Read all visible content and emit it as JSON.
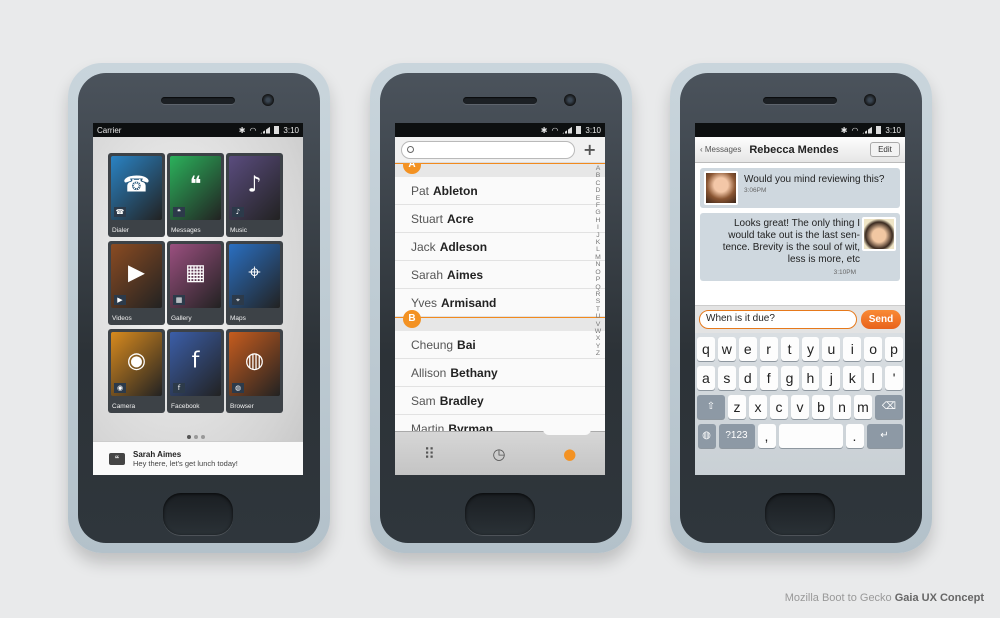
{
  "status": {
    "carrier": "Carrier",
    "time": "3:10"
  },
  "home": {
    "apps": [
      {
        "label": "Dialer",
        "color": "#2a83c4",
        "icon": "phone-icon"
      },
      {
        "label": "Messages",
        "color": "#2bb15b",
        "icon": "quote-icon"
      },
      {
        "label": "Music",
        "color": "#5a4c7e",
        "icon": "music-note-icon"
      },
      {
        "label": "Videos",
        "color": "#8a4b22",
        "icon": "video-camera-icon"
      },
      {
        "label": "Gallery",
        "color": "#9a4f7f",
        "icon": "grid-icon"
      },
      {
        "label": "Maps",
        "color": "#2a6fc1",
        "icon": "map-pin-icon"
      },
      {
        "label": "Camera",
        "color": "#d88a1e",
        "icon": "camera-icon"
      },
      {
        "label": "Facebook",
        "color": "#3b5ea8",
        "icon": "facebook-icon"
      },
      {
        "label": "Browser",
        "color": "#c65c1e",
        "icon": "globe-icon"
      }
    ],
    "notification": {
      "name": "Sarah Aimes",
      "text": "Hey there, let's get lunch today!"
    }
  },
  "contacts": {
    "sections": [
      {
        "letter": "A",
        "people": [
          {
            "first": "Pat",
            "last": "Ableton"
          },
          {
            "first": "Stuart",
            "last": "Acre"
          },
          {
            "first": "Jack",
            "last": "Adleson"
          },
          {
            "first": "Sarah",
            "last": "Aimes"
          },
          {
            "first": "Yves",
            "last": "Armisand"
          }
        ]
      },
      {
        "letter": "B",
        "people": [
          {
            "first": "Cheung",
            "last": "Bai"
          },
          {
            "first": "Allison",
            "last": "Bethany"
          },
          {
            "first": "Sam",
            "last": "Bradley"
          },
          {
            "first": "Martin",
            "last": "Byrman"
          }
        ]
      }
    ],
    "alphabet": [
      "A",
      "B",
      "C",
      "D",
      "E",
      "F",
      "G",
      "H",
      "I",
      "J",
      "K",
      "L",
      "M",
      "N",
      "O",
      "P",
      "Q",
      "R",
      "S",
      "T",
      "U",
      "V",
      "W",
      "X",
      "Y",
      "Z"
    ]
  },
  "messages": {
    "back_label": "Messages",
    "title": "Rebecca Mendes",
    "edit_label": "Edit",
    "incoming": {
      "text": "Would you mind reviewing this?",
      "time": "3:06PM"
    },
    "outgoing": {
      "text": "Looks great! The only thing I would take out is the last sen-tence. Brevity is the soul of wit, less is more, etc",
      "time": "3:10PM"
    },
    "draft": "When is it due?",
    "send_label": "Send"
  },
  "keyboard": {
    "row1": [
      "q",
      "w",
      "e",
      "r",
      "t",
      "y",
      "u",
      "i",
      "o",
      "p"
    ],
    "row2": [
      "a",
      "s",
      "d",
      "f",
      "g",
      "h",
      "j",
      "k",
      "l",
      "'"
    ],
    "row3": [
      "z",
      "x",
      "c",
      "v",
      "b",
      "n",
      "m"
    ],
    "sym_label": "?123",
    "comma": ",",
    "period": "."
  },
  "caption": {
    "prefix": "Mozilla Boot to Gecko",
    "bold": "Gaia UX Concept"
  }
}
